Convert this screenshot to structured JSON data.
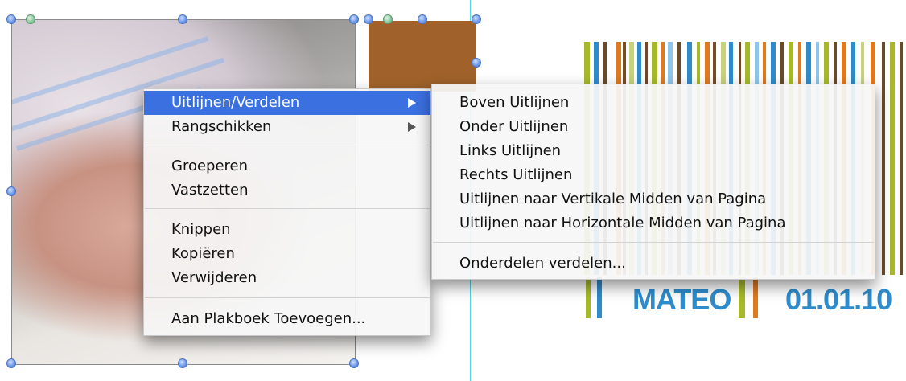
{
  "context_menu": {
    "items": [
      {
        "label": "Uitlijnen/Verdelen",
        "has_submenu": true,
        "highlighted": true
      },
      {
        "label": "Rangschikken",
        "has_submenu": true
      },
      {
        "label": "Groeperen"
      },
      {
        "label": "Vastzetten"
      },
      {
        "label": "Knippen"
      },
      {
        "label": "Kopiëren"
      },
      {
        "label": "Verwijderen"
      },
      {
        "label": "Aan Plakboek Toevoegen..."
      }
    ]
  },
  "submenu": {
    "items": [
      {
        "label": "Boven Uitlijnen"
      },
      {
        "label": "Onder Uitlijnen"
      },
      {
        "label": "Links Uitlijnen"
      },
      {
        "label": "Rechts Uitlijnen"
      },
      {
        "label": "Uitlijnen naar Vertikale Midden van Pagina"
      },
      {
        "label": "Uitlijnen naar Horizontale Midden van Pagina"
      },
      {
        "label": "Onderdelen verdelen..."
      }
    ]
  },
  "banner": {
    "name": "MATEO",
    "date": "01.01.10"
  },
  "colors": {
    "menu_highlight": "#3b70e0",
    "banner_text": "#2f8ccc",
    "brown_box": "#a0622a",
    "guide_line": "#4fd7e6"
  }
}
